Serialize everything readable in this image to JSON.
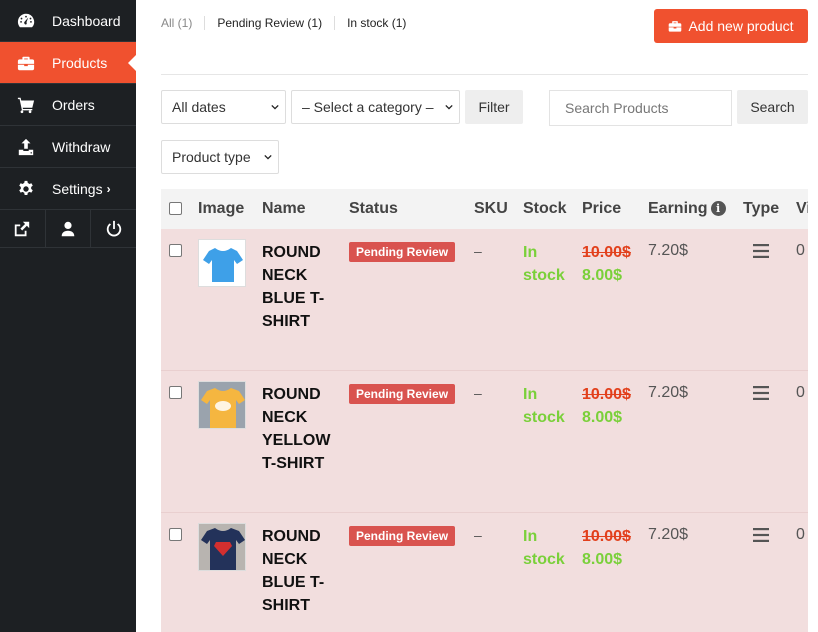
{
  "sidebar": {
    "items": [
      {
        "label": "Dashboard",
        "icon": "gauge-icon"
      },
      {
        "label": "Products",
        "icon": "briefcase-icon"
      },
      {
        "label": "Orders",
        "icon": "cart-icon"
      },
      {
        "label": "Withdraw",
        "icon": "upload-icon"
      },
      {
        "label": "Settings",
        "icon": "gear-icon",
        "chevron": "›"
      }
    ],
    "footer": [
      "external-link-icon",
      "user-icon",
      "power-icon"
    ]
  },
  "status_tabs": {
    "all": "All (1)",
    "pending": "Pending Review (1)",
    "in_stock": "In stock (1)"
  },
  "add_button": "Add new product",
  "filters": {
    "dates": "All dates",
    "category": "– Select a category –",
    "filter_label": "Filter",
    "search_placeholder": "Search Products",
    "search_label": "Search",
    "product_type": "Product type"
  },
  "table": {
    "headers": {
      "image": "Image",
      "name": "Name",
      "status": "Status",
      "sku": "SKU",
      "stock": "Stock",
      "price": "Price",
      "earning": "Earning",
      "type": "Type",
      "views": "Vi"
    },
    "rows": [
      {
        "name": "ROUND NECK BLUE T-SHIRT",
        "status": "Pending Review",
        "sku": "–",
        "stock": "In stock",
        "regular_price": "10.00$",
        "sale_price": "8.00$",
        "earning": "7.20$",
        "views": "0",
        "thumb_color": "#3ea0e8"
      },
      {
        "name": "ROUND NECK YELLOW T-SHIRT",
        "status": "Pending Review",
        "sku": "–",
        "stock": "In stock",
        "regular_price": "10.00$",
        "sale_price": "8.00$",
        "earning": "7.20$",
        "views": "0",
        "thumb_color": "#f5b640"
      },
      {
        "name": "ROUND NECK BLUE T-SHIRT",
        "status": "Pending Review",
        "sku": "–",
        "stock": "In stock",
        "regular_price": "10.00$",
        "sale_price": "8.00$",
        "earning": "7.20$",
        "views": "0",
        "thumb_color": "#23325a"
      }
    ]
  },
  "colors": {
    "accent": "#f0512f",
    "sidebar_bg": "#1d2023",
    "row_pending_bg": "#f2dede",
    "badge_red": "#d9534f",
    "stock_green": "#7ad03a",
    "price_strike_red": "#e2401c"
  }
}
